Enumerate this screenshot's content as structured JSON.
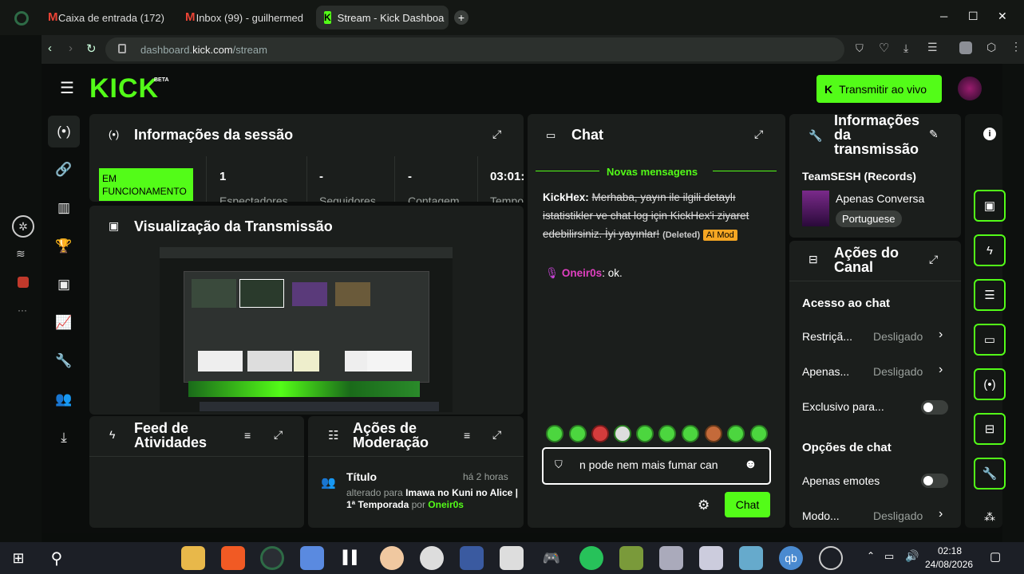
{
  "browser": {
    "tabs": [
      {
        "label": "Caixa de entrada (172)"
      },
      {
        "label": "Inbox (99) - guilhermed"
      },
      {
        "label": "Stream - Kick Dashboa"
      }
    ],
    "url_host": "dashboard.",
    "url_domain": "kick.com",
    "url_path": "/stream",
    "new_tab": "+",
    "win_min": "─",
    "win_max": "☐",
    "win_close": "✕"
  },
  "header": {
    "logo": "KICK",
    "beta": "BETA",
    "go_live_label": "Transmitir ao vivo"
  },
  "session": {
    "title": "Informações da sessão",
    "status": "EM FUNCIONAMENTO",
    "stats": [
      {
        "value": "1",
        "label": "Espectadores"
      },
      {
        "value": "-",
        "label": "Seguidores"
      },
      {
        "value": "-",
        "label": "Contagem"
      },
      {
        "value": "03:01:",
        "label": "Tempo"
      }
    ]
  },
  "preview": {
    "title": "Visualização da Transmissão"
  },
  "activity": {
    "title": "Feed de Atividades"
  },
  "moderation": {
    "title": "Ações de Moderação",
    "item_title": "Título",
    "item_time": "há 2 horas",
    "item_prefix": "alterado para",
    "item_value": "Imawa no Kuni no Alice | 1ª Temporada",
    "item_by": "por",
    "item_user": "Oneir0s"
  },
  "chat": {
    "title": "Chat",
    "new_messages": "Novas mensagens",
    "msg1_user": "KickHex:",
    "msg1_text": "Merhaba, yayın ile ilgili detaylı istatistikler ve chat log için KickHex'i ziyaret edebilirsiniz. İyi yayınlar!",
    "msg1_deleted": "(Deleted)",
    "msg1_badge": "AI Mod",
    "msg2_user": "Oneir0s",
    "msg2_text": ": ok.",
    "input_value": "n pode nem mais fumar can",
    "send_label": "Chat"
  },
  "stream_info": {
    "title": "Informações da transmissão",
    "channel": "TeamSESH (Records)",
    "category": "Apenas Conversa",
    "language": "Portuguese"
  },
  "channel_actions": {
    "title": "Ações do Canal",
    "chat_access": "Acesso ao chat",
    "rows": [
      {
        "label": "Restriçã...",
        "value": "Desligado"
      },
      {
        "label": "Apenas...",
        "value": "Desligado"
      }
    ],
    "exclusive": "Exclusivo para...",
    "chat_options": "Opções de chat",
    "emotes_only": "Apenas emotes",
    "mode_label": "Modo...",
    "mode_value": "Desligado"
  },
  "taskbar": {
    "time": "02:18",
    "date": "24/08/2026"
  },
  "colors": {
    "accent": "#53fc18",
    "panel": "#1b1e1c",
    "ai_mod": "#f5a623",
    "username": "#e040c0"
  }
}
